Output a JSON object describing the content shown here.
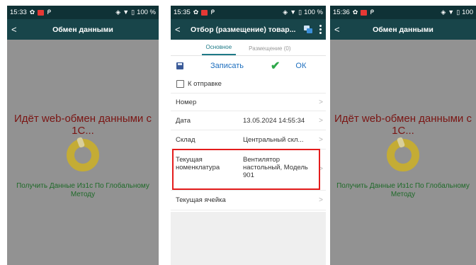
{
  "screens": [
    {
      "status": {
        "time": "15:33",
        "battery": "100 %"
      },
      "title": "Обмен данными",
      "message": "Идёт web-обмен данными с 1С...",
      "submessage": "Получить Данные Из1с По Глобальному Методу"
    },
    {
      "status": {
        "time": "15:35",
        "battery": "100 %"
      },
      "title": "Отбор (размещение) товар...",
      "tabs": [
        "Основное",
        "Размещение (0)"
      ],
      "toolbar": {
        "save_label": "Записать",
        "ok_label": "ОК"
      },
      "checkbox_label": "К отправке",
      "fields": {
        "number": {
          "label": "Номер",
          "value": ""
        },
        "date": {
          "label": "Дата",
          "value": "13.05.2024 14:55:34"
        },
        "warehouse": {
          "label": "Склад",
          "value": "Центральный скл..."
        },
        "nomenclature": {
          "label": "Текущая номенклатура",
          "value": "Вентилятор настольный, Модель 901"
        },
        "cell": {
          "label": "Текущая ячейка",
          "value": ""
        }
      }
    },
    {
      "status": {
        "time": "15:36",
        "battery": "100"
      },
      "title": "Обмен данными",
      "message": "Идёт web-обмен данными с 1С...",
      "submessage": "Получить Данные Из1с По Глобальному Методу"
    }
  ],
  "colors": {
    "statusbar": "#0f3236",
    "appbar": "#18454a",
    "overlay": "#929292",
    "message_red": "#7a1513",
    "submessage_green": "#1f6a29",
    "spinner": "#c4ac35",
    "highlight": "#e41c1c",
    "link_blue": "#1e6fbf",
    "ok_green": "#2ea84a"
  },
  "icons": [
    "back-arrow-icon",
    "copy-icon",
    "more-vert-icon",
    "save-disk-icon",
    "checkmark-icon",
    "chevron-right-icon",
    "spinner-icon",
    "settings-icon",
    "location-icon",
    "wifi-icon",
    "battery-icon"
  ]
}
